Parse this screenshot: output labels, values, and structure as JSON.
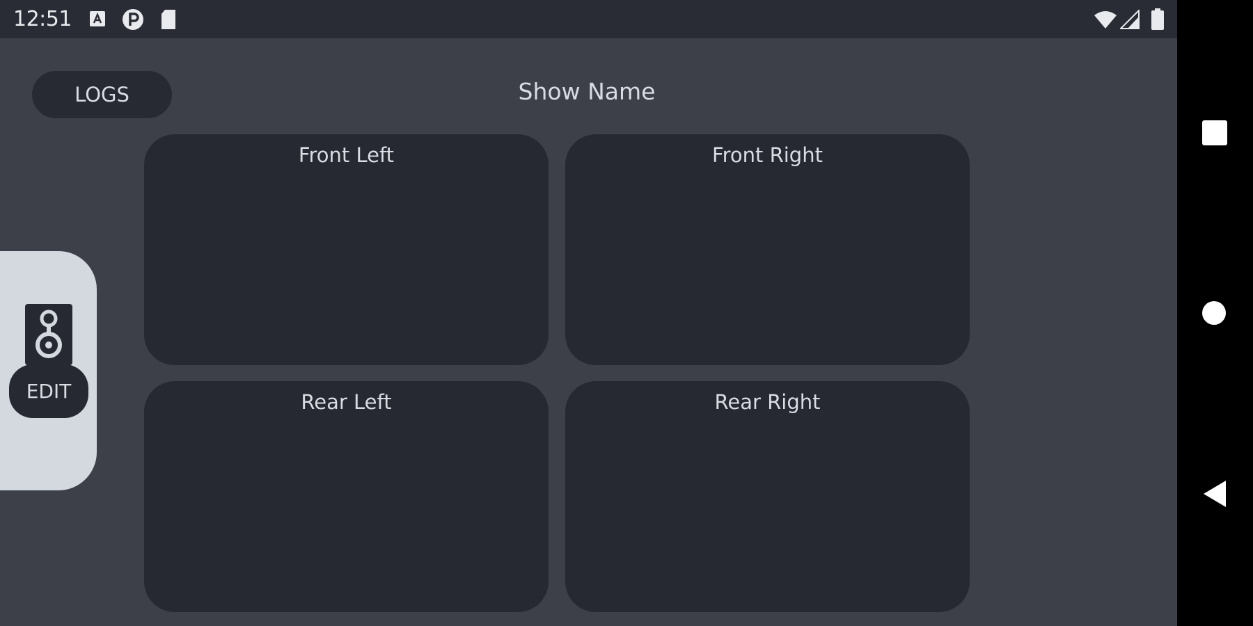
{
  "status_bar": {
    "time": "12:51",
    "left_icons": [
      "text-notification-icon",
      "pinterest-icon",
      "sd-card-icon"
    ],
    "right_icons": [
      "wifi-icon",
      "cell-signal-icon",
      "battery-icon"
    ]
  },
  "header": {
    "logs_label": "LOGS",
    "show_name": "Show Name"
  },
  "panels": [
    {
      "label": "Front Left"
    },
    {
      "label": "Front Right"
    },
    {
      "label": "Rear Left"
    },
    {
      "label": "Rear Right"
    }
  ],
  "side_panel": {
    "icon": "speaker-icon",
    "edit_label": "EDIT"
  },
  "nav_bar": {
    "buttons": [
      "recents-icon",
      "home-icon",
      "back-icon"
    ]
  },
  "colors": {
    "background": "#3d4049",
    "status_bar": "#292c34",
    "panel": "#262931",
    "side_panel": "#d3d9de",
    "text": "#d9dce2"
  }
}
